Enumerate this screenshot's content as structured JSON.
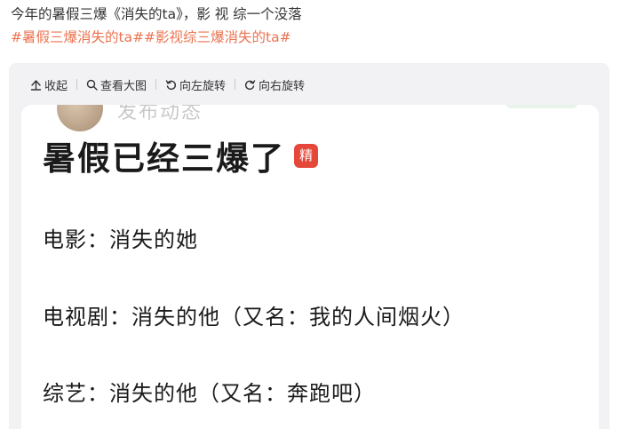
{
  "post": {
    "text": "今年的暑假三爆《消失的ta》，影 视 综一个没落",
    "tags": "#暑假三爆消失的ta##影视综三爆消失的ta#"
  },
  "toolbar": {
    "collapse": "收起",
    "view_large": "查看大图",
    "rotate_left": "向左旋转",
    "rotate_right": "向右旋转"
  },
  "image": {
    "cut_name": "发布动态",
    "headline": "暑假已经三爆了",
    "badge": "精",
    "lines": [
      "电影：消失的她",
      "电视剧：消失的他（又名：我的人间烟火）",
      "综艺：消失的他（又名：奔跑吧）"
    ]
  },
  "colors": {
    "tag": "#eb7350",
    "badge": "#e5483a",
    "panel": "#f2f2f5"
  }
}
